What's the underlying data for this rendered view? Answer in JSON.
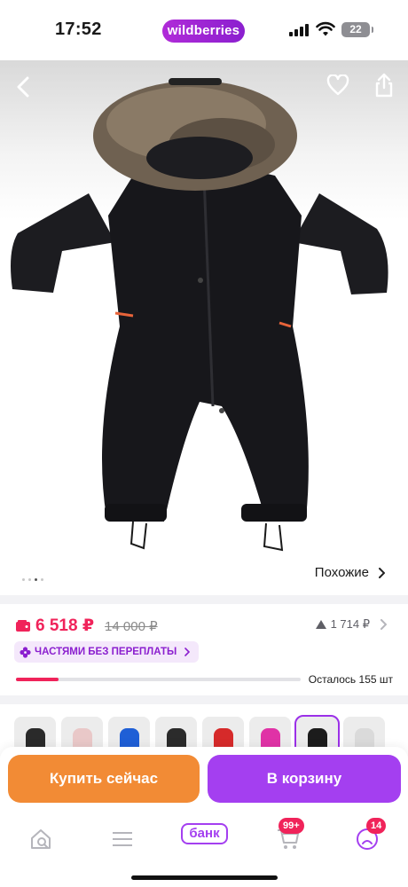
{
  "status_bar": {
    "time": "17:52",
    "brand": "wildberries",
    "battery": "22"
  },
  "product": {
    "similar_label": "Похожие",
    "price": "6 518 ₽",
    "old_price": "14 000 ₽",
    "rating_count": "1 714 ₽",
    "installment_label": "ЧАСТЯМИ БЕЗ ПЕРЕПЛАТЫ",
    "stock_label": "Осталось 155 шт",
    "stock_progress_fraction": 0.15,
    "gallery": {
      "count": 4,
      "active_index": 2
    }
  },
  "thumbnails": [
    {
      "color": "#2a2a2a"
    },
    {
      "color": "#e9c8c8"
    },
    {
      "color": "#1f5fd6"
    },
    {
      "color": "#2b2b2b"
    },
    {
      "color": "#d62a2a"
    },
    {
      "color": "#e032a6"
    },
    {
      "color": "#1c1c1c"
    },
    {
      "color": "#dadada"
    }
  ],
  "actions": {
    "buy_now": "Купить сейчас",
    "add_to_cart": "В корзину"
  },
  "nav": {
    "bank": "банк",
    "cart_badge": "99+",
    "profile_badge": "14"
  },
  "colors": {
    "brand": "#a43ff0",
    "price": "#f0235a",
    "buy": "#f28b35"
  }
}
